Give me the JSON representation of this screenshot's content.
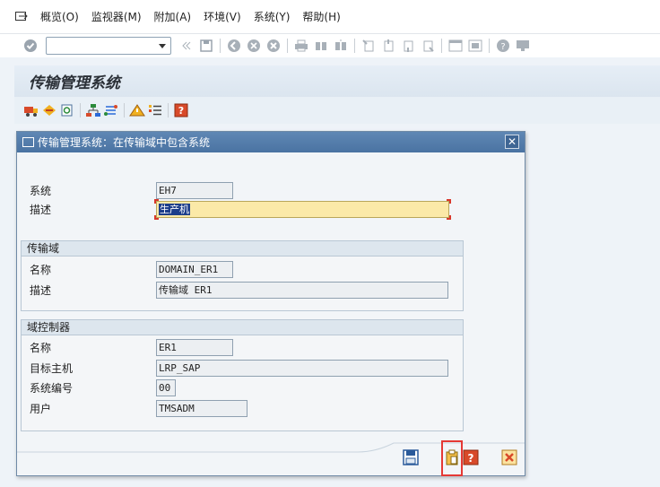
{
  "menubar": {
    "items": [
      "概览(O)",
      "监视器(M)",
      "附加(A)",
      "环境(V)",
      "系统(Y)",
      "帮助(H)"
    ]
  },
  "toolbar": {
    "command_value": "",
    "icons": [
      "enter-icon",
      "save-icon",
      "back-icon",
      "exit-icon",
      "cancel-icon",
      "print-icon",
      "find-icon",
      "find-next-icon",
      "first-page-icon",
      "prev-page-icon",
      "next-page-icon",
      "last-page-icon",
      "new-session-icon",
      "shortcut-icon",
      "help-icon",
      "layout-icon"
    ]
  },
  "title": "传输管理系统",
  "dialog": {
    "title": "传输管理系统：在传输域中包含系统",
    "system_label": "系统",
    "system_value": "EH7",
    "desc_label": "描述",
    "desc_value": "生产机",
    "domain_group": {
      "header": "传输域",
      "name_label": "名称",
      "name_value": "DOMAIN_ER1",
      "desc_label": "描述",
      "desc_value": "传输域 ER1"
    },
    "controller_group": {
      "header": "域控制器",
      "name_label": "名称",
      "name_value": "ER1",
      "host_label": "目标主机",
      "host_value": "LRP_SAP",
      "sysnr_label": "系统编号",
      "sysnr_value": "00",
      "user_label": "用户",
      "user_value": "TMSADM"
    }
  },
  "colors": {
    "dialog_title_bg": "#4a73a2",
    "editable_field_bg": "#fbe9a8",
    "highlight": "#e53935"
  }
}
